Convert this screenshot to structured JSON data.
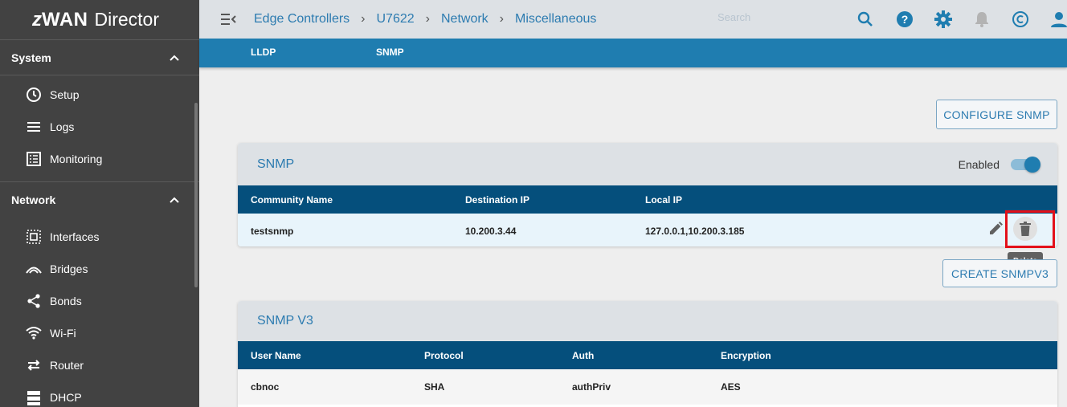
{
  "sidebar": {
    "logo": {
      "z": "z",
      "wan": "WAN",
      "director": "Director"
    },
    "sections": [
      {
        "title": "System",
        "items": [
          {
            "label": "Setup",
            "icon": "clock-icon"
          },
          {
            "label": "Logs",
            "icon": "list-icon"
          },
          {
            "label": "Monitoring",
            "icon": "monitoring-icon"
          }
        ]
      },
      {
        "title": "Network",
        "items": [
          {
            "label": "Interfaces",
            "icon": "interfaces-icon"
          },
          {
            "label": "Bridges",
            "icon": "bridge-icon"
          },
          {
            "label": "Bonds",
            "icon": "share-icon"
          },
          {
            "label": "Wi-Fi",
            "icon": "wifi-icon"
          },
          {
            "label": "Router",
            "icon": "swap-icon"
          },
          {
            "label": "DHCP",
            "icon": "server-icon"
          }
        ]
      }
    ]
  },
  "header": {
    "breadcrumb": [
      "Edge Controllers",
      "U7622",
      "Network",
      "Miscellaneous"
    ],
    "search_placeholder": "Search",
    "accent": "#2c7bb0"
  },
  "tabs": [
    {
      "label": "LLDP"
    },
    {
      "label": "SNMP"
    }
  ],
  "snmp": {
    "configure_label": "CONFIGURE SNMP",
    "title": "SNMP",
    "enabled_label": "Enabled",
    "enabled": true,
    "columns": [
      "Community Name",
      "Destination IP",
      "Local IP"
    ],
    "rows": [
      [
        "testsnmp",
        "10.200.3.44",
        "127.0.0.1,10.200.3.185"
      ]
    ],
    "delete_tooltip": "Delete"
  },
  "snmpv3": {
    "create_label": "CREATE SNMPV3",
    "title": "SNMP V3",
    "columns": [
      "User Name",
      "Protocol",
      "Auth",
      "Encryption"
    ],
    "rows": [
      [
        "cbnoc",
        "SHA",
        "authPriv",
        "AES"
      ]
    ]
  }
}
